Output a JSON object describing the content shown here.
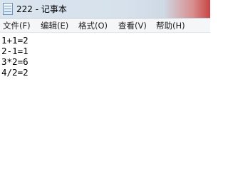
{
  "window": {
    "title": "222 - 记事本"
  },
  "menu": {
    "items": [
      {
        "label": "文件(F)"
      },
      {
        "label": "编辑(E)"
      },
      {
        "label": "格式(O)"
      },
      {
        "label": "查看(V)"
      },
      {
        "label": "帮助(H)"
      }
    ]
  },
  "editor": {
    "lines": [
      "1+1=2",
      "2-1=1",
      "3*2=6",
      "4/2=2"
    ]
  },
  "colors": {
    "title_bar": "#d9e4ef",
    "close_accent": "#c84444",
    "menu_bar": "#f5f6f7",
    "text": "#000000"
  }
}
